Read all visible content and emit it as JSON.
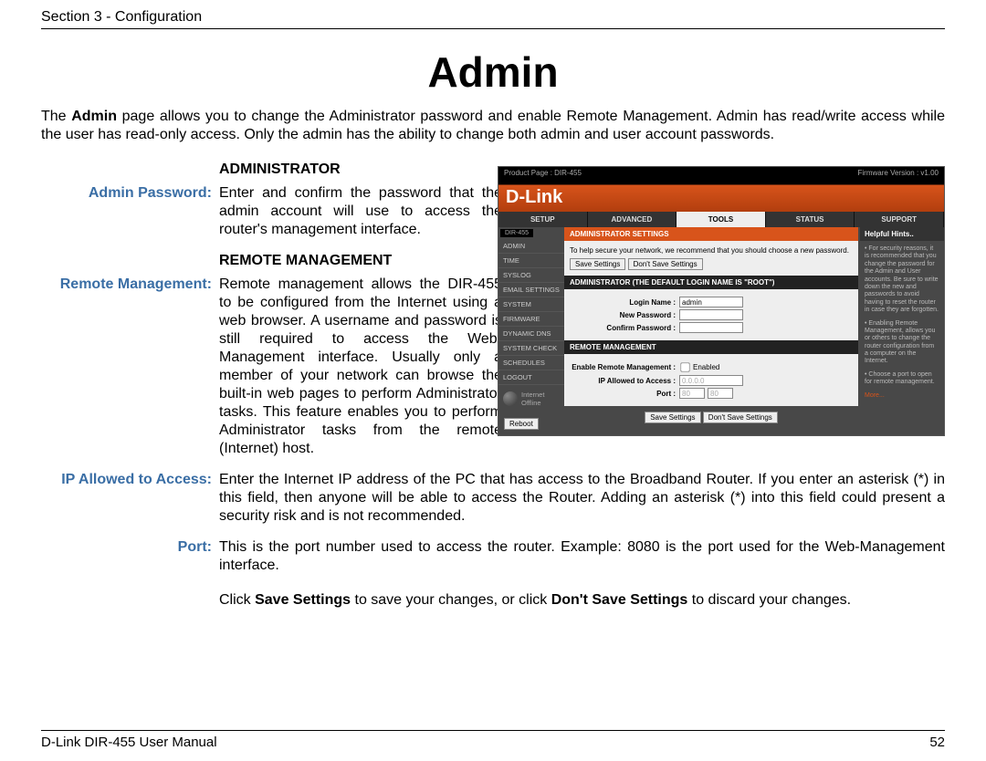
{
  "header": {
    "section": "Section 3 - Configuration"
  },
  "title": "Admin",
  "intro_prefix": "The ",
  "intro_bold": "Admin",
  "intro_suffix": " page allows you to change the Administrator password and enable Remote Management.  Admin has read/write access while the user has read-only access. Only the admin has the ability to change both admin and user account passwords.",
  "defs": {
    "h1": "ADMINISTRATOR",
    "admin_pw_label": "Admin Password:",
    "admin_pw_body": "Enter and confirm the password that the admin account will use to access the router's management interface.",
    "h2": "REMOTE MANAGEMENT",
    "rm_label": "Remote Management:",
    "rm_body": "Remote management allows the DIR-455 to be configured from the Internet using a web browser. A username and password is still required to access the Web-Management interface. Usually only a member of your network can browse the built-in web pages to perform Administrator tasks. This feature enables you to perform Administrator tasks from the remote (Internet) host.",
    "ip_label": "IP Allowed to Access:",
    "ip_body": "Enter the Internet IP address of the PC that has access to the Broadband Router. If you enter an asterisk (*) in this field, then anyone will be able to access the Router. Adding an asterisk (*) into this field could present a security risk and is not recommended.",
    "port_label": "Port:",
    "port_body": "This is the port number used to access the router. Example: 8080 is the port used for the Web-Management interface."
  },
  "closing_pre": "Click ",
  "closing_b1": "Save Settings",
  "closing_mid": " to save your changes, or click ",
  "closing_b2": "Don't Save Settings",
  "closing_post": " to discard your changes.",
  "footer": {
    "manual": "D-Link DIR-455 User Manual",
    "page": "52"
  },
  "shot": {
    "product_page": "Product Page : DIR-455",
    "fw": "Firmware Version : v1.00",
    "logo": "D-Link",
    "chip": "DIR-455",
    "side_items": [
      "ADMIN",
      "TIME",
      "SYSLOG",
      "EMAIL SETTINGS",
      "SYSTEM",
      "FIRMWARE",
      "DYNAMIC DNS",
      "SYSTEM CHECK",
      "SCHEDULES",
      "LOGOUT"
    ],
    "internet": "Internet",
    "offline": "Offline",
    "reboot": "Reboot",
    "tabs": [
      "SETUP",
      "ADVANCED",
      "TOOLS",
      "STATUS",
      "SUPPORT"
    ],
    "active_tab": 2,
    "p1_title": "ADMINISTRATOR  SETTINGS",
    "p1_text": "To help secure your network, we recommend that you should choose a new password.",
    "save": "Save Settings",
    "dont": "Don't Save Settings",
    "p2_title": "ADMINISTRATOR (THE DEFAULT LOGIN NAME IS \"root\")",
    "login_label": "Login Name :",
    "login_value": "admin",
    "newpw_label": "New Password :",
    "confirm_label": "Confirm Password :",
    "p3_title": "REMOTE MANAGEMENT",
    "enable_label": "Enable Remote Management :",
    "enabled_text": "Enabled",
    "ip_allowed_label": "IP Allowed to Access :",
    "ip_allowed_value": "0.0.0.0",
    "port_field_label": "Port :",
    "port_a": "80",
    "port_b": "80",
    "hints_title": "Helpful Hints..",
    "hints_p1": "• For security reasons, it is recommended that you change the password for the Admin and User accounts. Be sure to write down the new and passwords to avoid having to reset the router in case they are forgotten.",
    "hints_p2": "• Enabling Remote Management, allows you or others to change the router configuration from a computer on the Internet.",
    "hints_p3": "• Choose a port to open for remote management.",
    "hints_more": "More..."
  }
}
